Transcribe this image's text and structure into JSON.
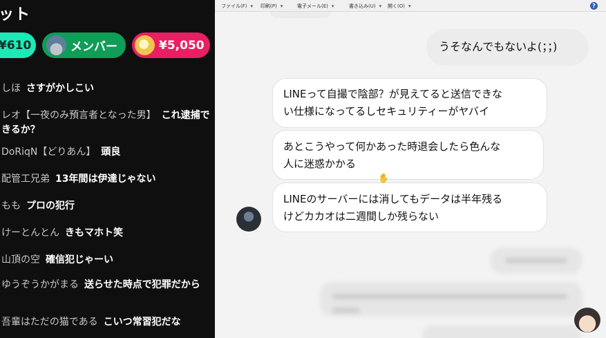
{
  "chat": {
    "title": "ット",
    "chips": {
      "yen610": "¥610",
      "member": "メンバー",
      "yen5050": "¥5,050"
    },
    "messages": [
      {
        "author": "しほ",
        "text": "さすがかしこい"
      },
      {
        "author": "レオ【一夜のみ預言者となった男】",
        "text": "これ逮捕できるか？"
      },
      {
        "author": "DoRiqN【どりあん】",
        "text": "頭良"
      },
      {
        "author": "配管工兄弟",
        "text": "13年間は伊達じゃない"
      },
      {
        "author": "もも",
        "text": "プロの犯行"
      },
      {
        "author": "けーとんとん",
        "text": "きもマホト笑"
      },
      {
        "author": "山頂の空",
        "text": "確信犯じゃーい"
      },
      {
        "author": "ゆうぞうかがまる",
        "text": "送らせた時点で犯罪だから"
      },
      {
        "author": "吾輩はただの猫である",
        "text": "こいつ常習犯だな"
      }
    ]
  },
  "menu": {
    "file": "ファイル(F)",
    "print": "印刷(P)",
    "email": "電子メール(E)",
    "write": "書き込み(U)",
    "open": "開く(O)",
    "help": "?"
  },
  "conversation": {
    "outgoing": "うそなんでもないよ(；；)",
    "incoming": [
      {
        "line1": "LINEって自撮で陰部？が見えてると送信できな",
        "line2": "い仕様になってるしセキュリティーがヤバイ"
      },
      {
        "line1": "あとこうやって何かあった時退会したら色んな",
        "line2": "人に迷惑かかる"
      },
      {
        "line1": "LINEのサーバーには消してもデータは半年残る",
        "line2": "けどカカオは二週間しか残らない"
      }
    ]
  }
}
